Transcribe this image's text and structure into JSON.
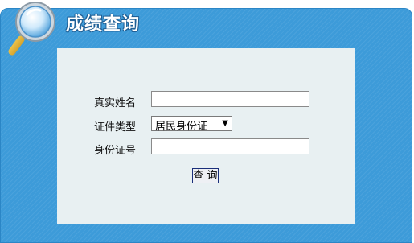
{
  "header": {
    "title": "成绩查询",
    "icon": "magnifier-icon"
  },
  "form": {
    "name_label": "真实姓名",
    "name_value": "",
    "id_type_label": "证件类型",
    "id_type_selected": "居民身份证",
    "id_number_label": "身份证号",
    "id_number_value": "",
    "submit_label": "查 询"
  },
  "colors": {
    "panel": "#3d9bd9",
    "form_bg": "#e8f0f2",
    "title_text": "#ffffff"
  }
}
